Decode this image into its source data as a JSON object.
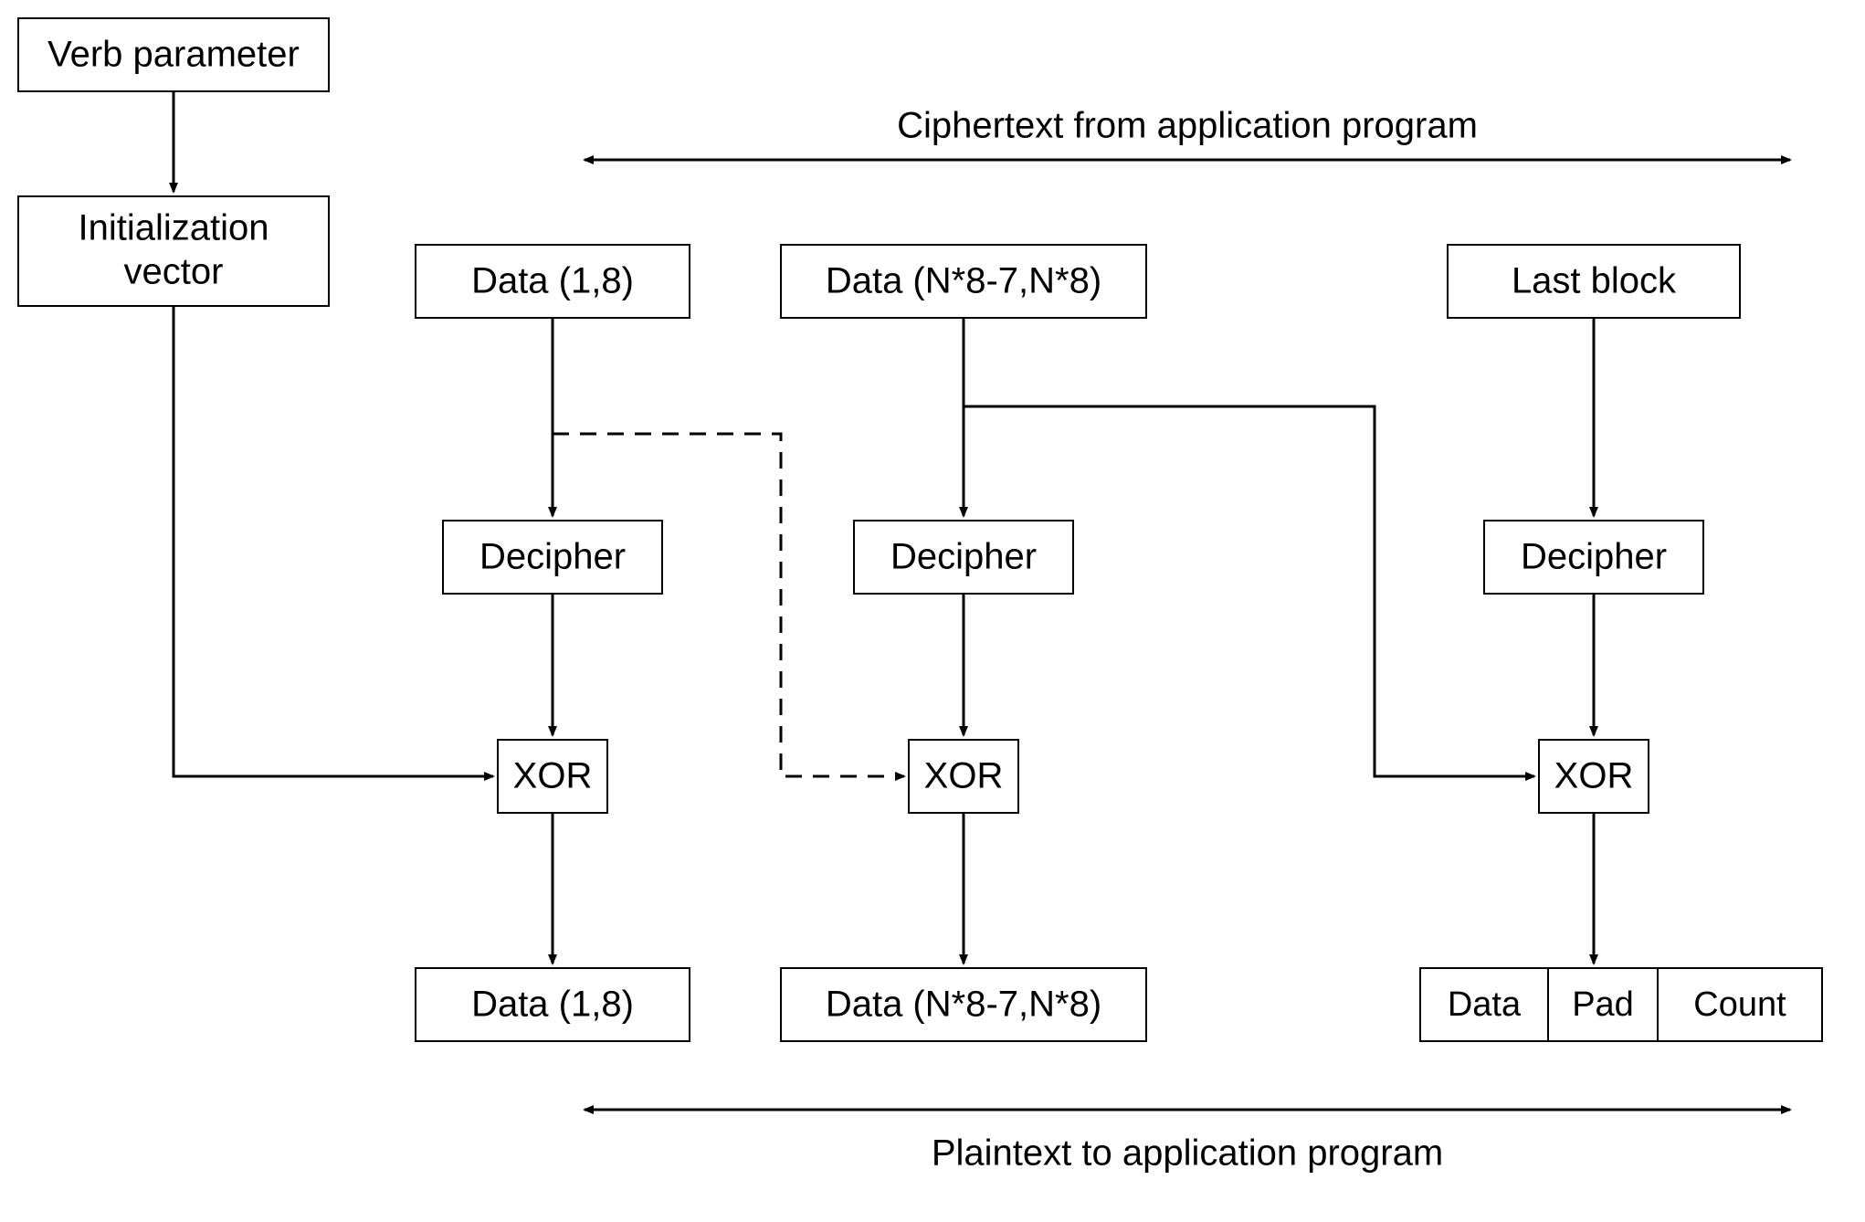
{
  "verb_parameter": "Verb parameter",
  "initialization_vector_l1": "Initialization",
  "initialization_vector_l2": "vector",
  "ciphertext_label": "Ciphertext from application program",
  "data_1_8_top": "Data (1,8)",
  "data_n_top": "Data (N*8-7,N*8)",
  "last_block": "Last block",
  "decipher": "Decipher",
  "xor": "XOR",
  "data_1_8_bottom": "Data (1,8)",
  "data_n_bottom": "Data (N*8-7,N*8)",
  "data_small": "Data",
  "pad_small": "Pad",
  "count_small": "Count",
  "plaintext_label": "Plaintext to application program"
}
